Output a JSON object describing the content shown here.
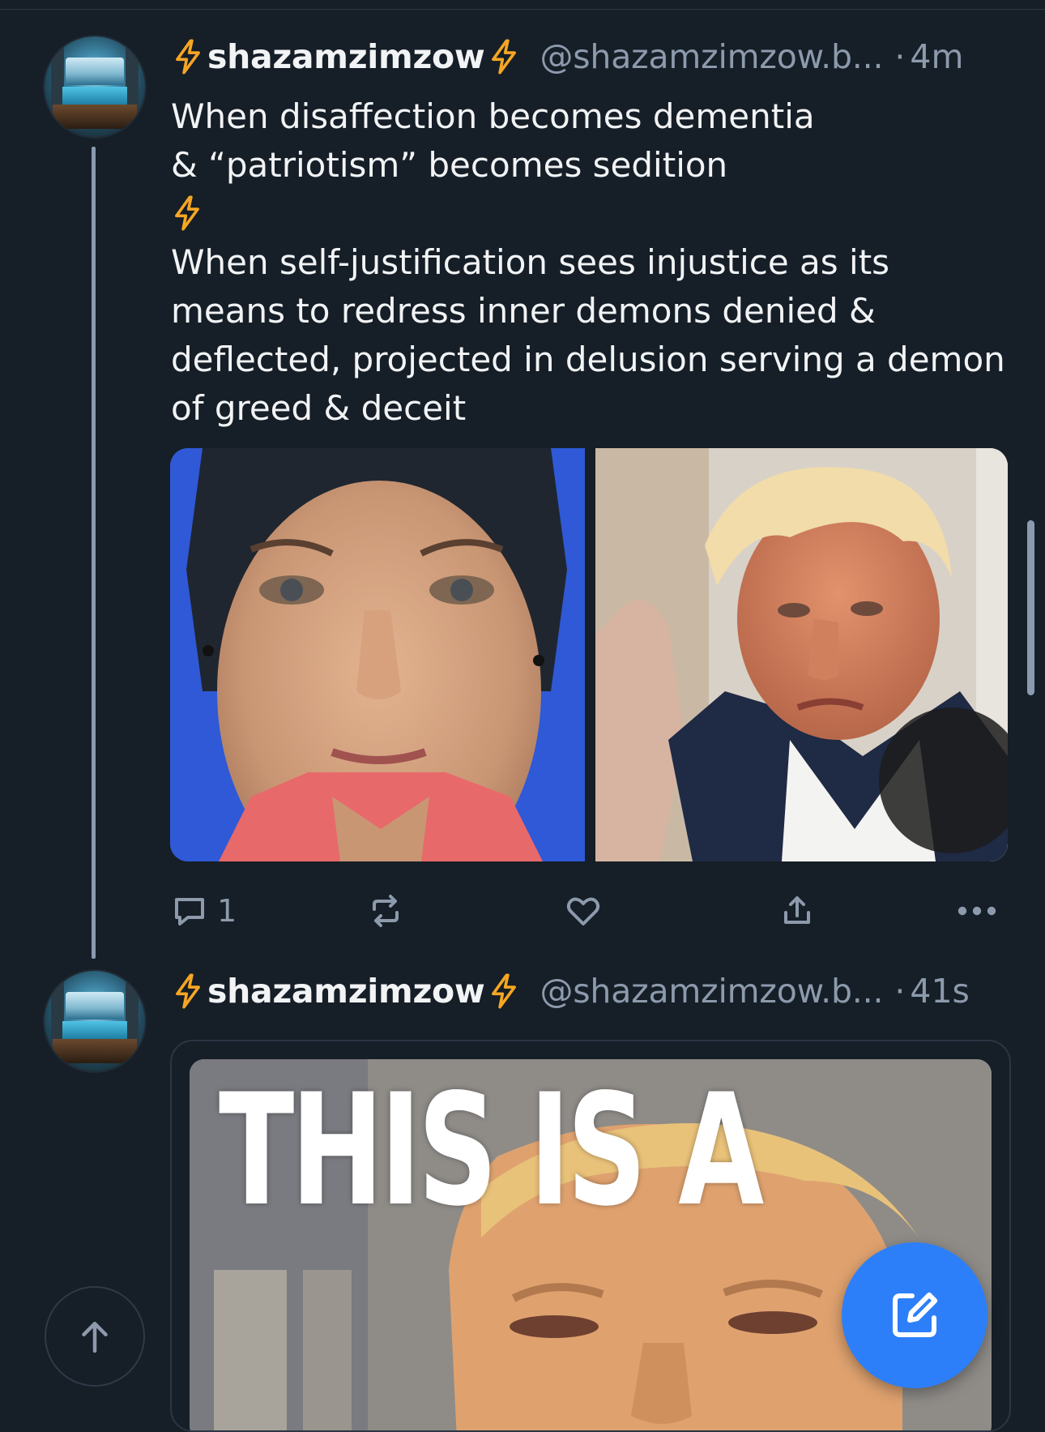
{
  "colors": {
    "background": "#161e27",
    "accent": "#2d7ff9",
    "muted_text": "#8c9aac",
    "bolt": "#f5a623"
  },
  "posts": [
    {
      "author_name": "shazamzimzow",
      "handle": "@shazamzimzow.b...",
      "dot": "·",
      "time": "4m",
      "text_lines": [
        "When disaffection becomes dementia",
        "& “patriotism” becomes sedition",
        "When self-justification sees injustice as its",
        "means to redress inner demons denied &",
        "deflected, projected in delusion serving a demon",
        "of greed & deceit"
      ],
      "images": [
        "photo-portrait-woman",
        "photo-man-in-suit"
      ],
      "reply_count": "1"
    },
    {
      "author_name": "shazamzimzow",
      "handle": "@shazamzimzow.b...",
      "dot": "·",
      "time": "41s",
      "quote_image_text": "THIS IS A"
    }
  ],
  "icons": {
    "bolt": "lightning-bolt-icon",
    "reply": "speech-bubble-icon",
    "repost": "repost-arrows-icon",
    "like": "heart-icon",
    "share": "share-upload-icon",
    "more": "more-dots-icon",
    "scroll_top": "arrow-up-icon",
    "compose": "compose-pencil-icon"
  }
}
